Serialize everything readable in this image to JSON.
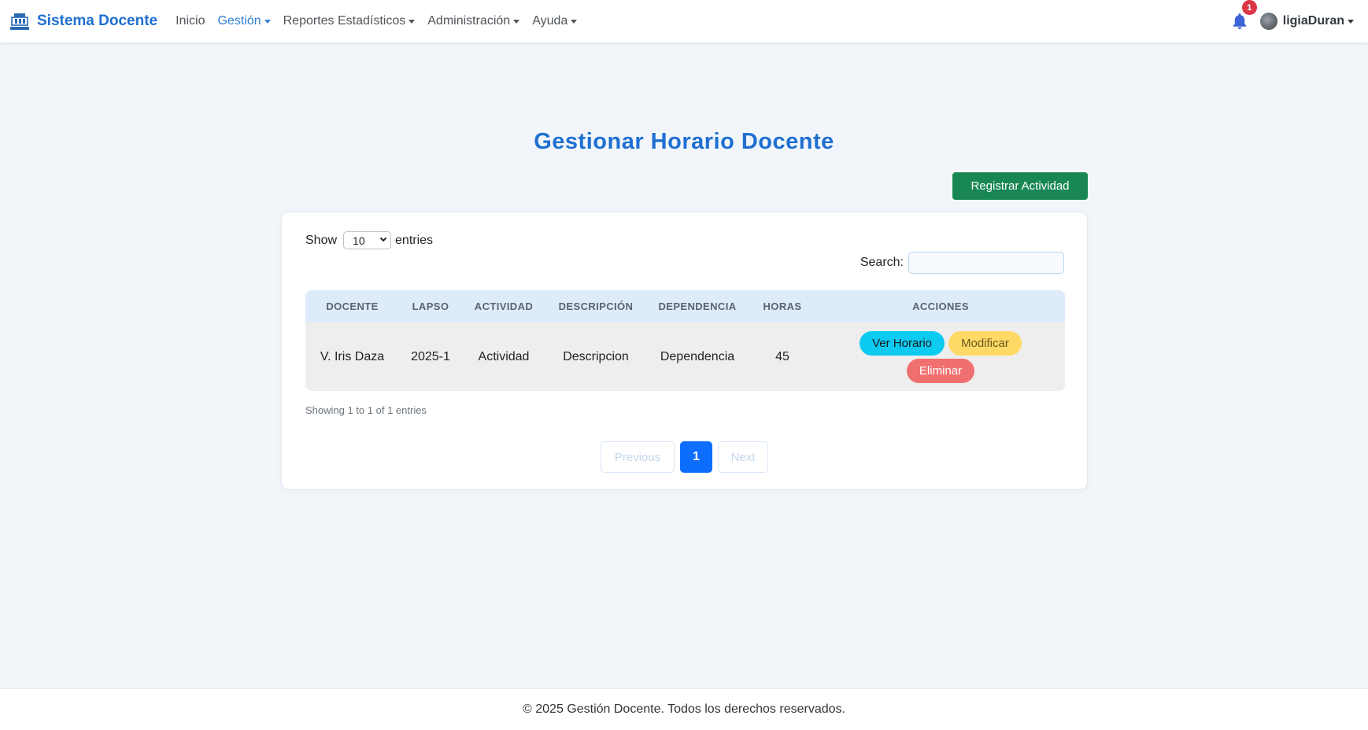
{
  "colors": {
    "brand": "#1f6fd1",
    "success": "#198754",
    "info": "#0dcaf0",
    "warning": "#ffd966",
    "danger": "#f07070",
    "primary": "#0d6efd",
    "notification": "#dc3545"
  },
  "navbar": {
    "brand_name": "Sistema Docente",
    "logo_icon": "university-logo-icon",
    "items": [
      {
        "label": "Inicio",
        "dropdown": false,
        "active": false
      },
      {
        "label": "Gestión",
        "dropdown": true,
        "active": true
      },
      {
        "label": "Reportes Estadísticos",
        "dropdown": true,
        "active": false
      },
      {
        "label": "Administración",
        "dropdown": true,
        "active": false
      },
      {
        "label": "Ayuda",
        "dropdown": true,
        "active": false
      }
    ],
    "notifications_icon": "bell-icon",
    "notification_count": "1",
    "user_name": "ligiaDuran"
  },
  "main": {
    "title": "Gestionar Horario Docente",
    "register_button": "Registrar Actividad"
  },
  "table_controls": {
    "show_label": "Show",
    "length_value": "10",
    "entries_label": "entries",
    "search_label": "Search:",
    "search_value": ""
  },
  "table": {
    "headers": [
      "DOCENTE",
      "LAPSO",
      "ACTIVIDAD",
      "DESCRIPCIÓN",
      "DEPENDENCIA",
      "HORAS",
      "ACCIONES"
    ],
    "rows": [
      {
        "docente": "V. Iris Daza",
        "lapso": "2025-1",
        "actividad": "Actividad",
        "descripcion": "Descripcion",
        "dependencia": "Dependencia",
        "horas": "45",
        "actions": {
          "view": "Ver Horario",
          "edit": "Modificar",
          "delete": "Eliminar"
        }
      }
    ]
  },
  "info": "Showing 1 to 1 of 1 entries",
  "pagination": {
    "previous": "Previous",
    "current": "1",
    "next": "Next"
  },
  "footer": {
    "text": "© 2025 Gestión Docente. Todos los derechos reservados."
  }
}
